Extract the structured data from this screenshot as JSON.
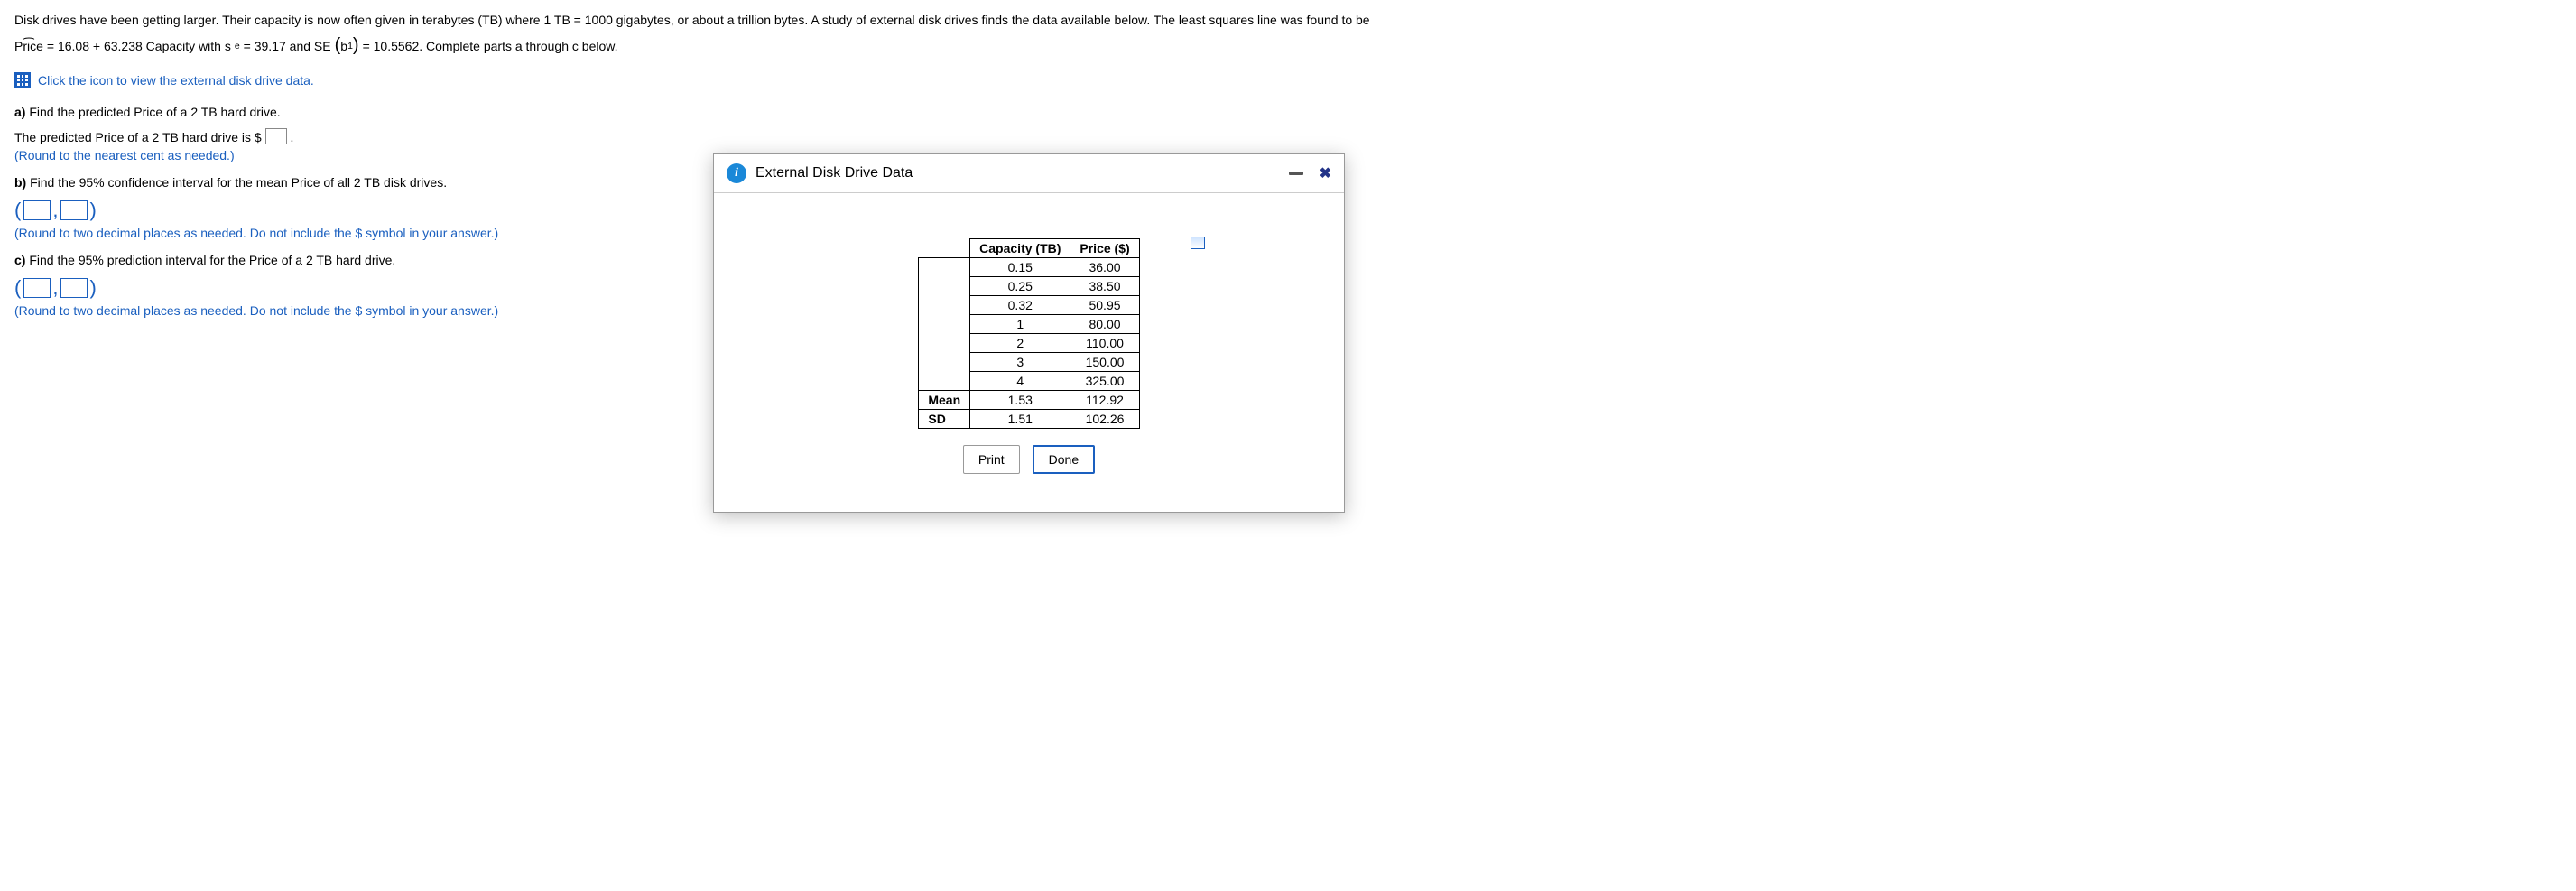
{
  "intro": {
    "line1": "Disk drives have been getting larger. Their capacity is now often given in terabytes (TB) where 1 TB = 1000 gigabytes, or about a trillion bytes. A study of external disk drives finds the data available below. The least squares line was found to be",
    "price_hat": "Price",
    "eq1": " = 16.08 + 63.238 Capacity with s",
    "sub_e": "e",
    "eq2": " = 39.17 and SE",
    "b1_l": "(",
    "b1": "b",
    "b1_sub": "1",
    "b1_r": ")",
    "eq3": " = 10.5562. Complete parts a through c below."
  },
  "data_link": "Click the icon to view the external disk drive data.",
  "part_a": {
    "title_bold": "a)",
    "title_rest": " Find the predicted Price of a 2 TB hard drive.",
    "sentence_pre": "The predicted Price of a 2 TB hard drive is $",
    "sentence_post": ".",
    "hint": "(Round to the nearest cent as needed.)"
  },
  "part_b": {
    "title_bold": "b)",
    "title_rest": " Find the 95% confidence interval for the mean Price of all 2 TB disk drives.",
    "hint": "(Round to two decimal places as needed. Do not include the $ symbol in your answer.)"
  },
  "part_c": {
    "title_bold": "c)",
    "title_rest": " Find the 95% prediction interval for the Price of a 2 TB hard drive.",
    "hint": "(Round to two decimal places as needed. Do not include the $ symbol in your answer.)"
  },
  "dialog": {
    "title": "External Disk Drive Data",
    "headers": {
      "col1": "Capacity (TB)",
      "col2": "Price ($)"
    },
    "rows": [
      {
        "label": "",
        "cap": "0.15",
        "price": "36.00"
      },
      {
        "label": "",
        "cap": "0.25",
        "price": "38.50"
      },
      {
        "label": "",
        "cap": "0.32",
        "price": "50.95"
      },
      {
        "label": "",
        "cap": "1",
        "price": "80.00"
      },
      {
        "label": "",
        "cap": "2",
        "price": "110.00"
      },
      {
        "label": "",
        "cap": "3",
        "price": "150.00"
      },
      {
        "label": "",
        "cap": "4",
        "price": "325.00"
      },
      {
        "label": "Mean",
        "cap": "1.53",
        "price": "112.92"
      },
      {
        "label": "SD",
        "cap": "1.51",
        "price": "102.26"
      }
    ],
    "buttons": {
      "print": "Print",
      "done": "Done"
    }
  }
}
